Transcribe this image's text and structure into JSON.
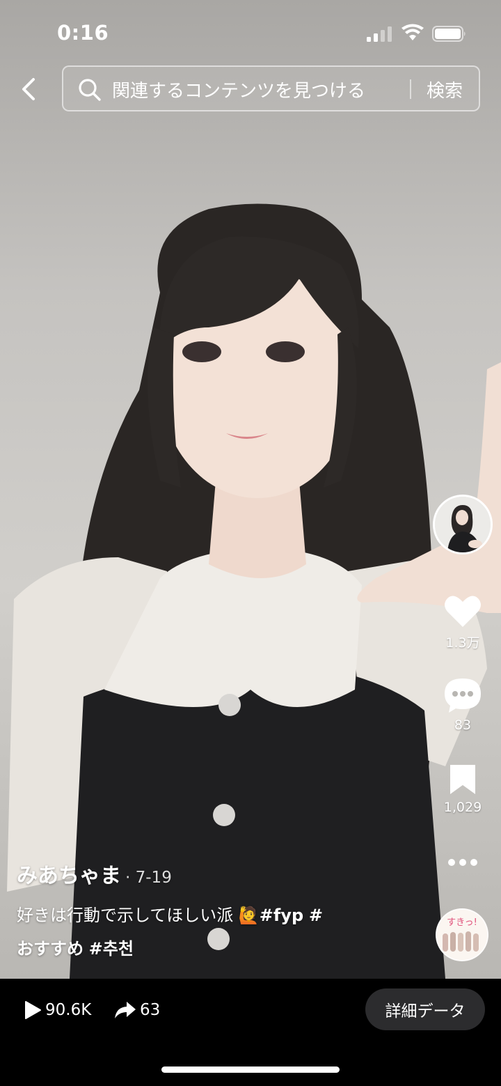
{
  "status_bar": {
    "time": "0:16"
  },
  "search": {
    "placeholder": "関連するコンテンツを見つける",
    "submit_label": "検索"
  },
  "actions": {
    "likes": "1.3万",
    "comments": "83",
    "saves": "1,029"
  },
  "post": {
    "author": "みあちゃま",
    "date": "· 7-19",
    "description": "好きは行動で示してほしい派 🙋",
    "hashtags": [
      "#fyp",
      "#",
      "おすすめ",
      "#추천"
    ]
  },
  "music_disc": {
    "text": "すきっ!"
  },
  "stats": {
    "plays": "90.6K",
    "shares": "63"
  },
  "insights_label": "詳細データ",
  "colors": {
    "background": "#000000",
    "button": "#2c2c2e",
    "text": "#ffffff"
  }
}
